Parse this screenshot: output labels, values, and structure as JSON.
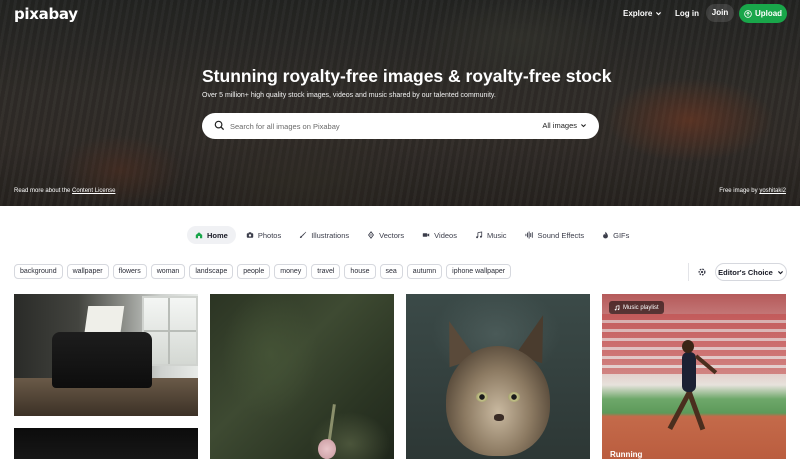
{
  "brand": {
    "logo_text": "pixabay",
    "accent_color": "#19a64a"
  },
  "nav": {
    "explore_label": "Explore",
    "login_label": "Log in",
    "join_label": "Join",
    "upload_label": "Upload"
  },
  "hero": {
    "title": "Stunning royalty-free images & royalty-free stock",
    "subtitle": "Over 5 million+ high quality stock images, videos and music shared by our talented community.",
    "license_prefix": "Read more about the",
    "license_link": "Content License",
    "credit_prefix": "Free image by",
    "credit_author": "yoshitaki2"
  },
  "search": {
    "placeholder": "Search for all images on Pixabay",
    "filter_label": "All images"
  },
  "tabs": [
    {
      "label": "Home",
      "icon": "home-icon",
      "active": true
    },
    {
      "label": "Photos",
      "icon": "camera-icon"
    },
    {
      "label": "Illustrations",
      "icon": "brush-icon"
    },
    {
      "label": "Vectors",
      "icon": "pen-nib-icon"
    },
    {
      "label": "Videos",
      "icon": "video-camera-icon"
    },
    {
      "label": "Music",
      "icon": "music-note-icon"
    },
    {
      "label": "Sound Effects",
      "icon": "sound-wave-icon"
    },
    {
      "label": "GIFs",
      "icon": "flame-icon"
    }
  ],
  "tags": [
    "background",
    "wallpaper",
    "flowers",
    "woman",
    "landscape",
    "people",
    "money",
    "travel",
    "house",
    "sea",
    "autumn",
    "iphone wallpaper"
  ],
  "sort": {
    "label": "Editor's Choice"
  },
  "gallery": {
    "music_badge": "Music playlist",
    "runner_caption": "Running"
  }
}
